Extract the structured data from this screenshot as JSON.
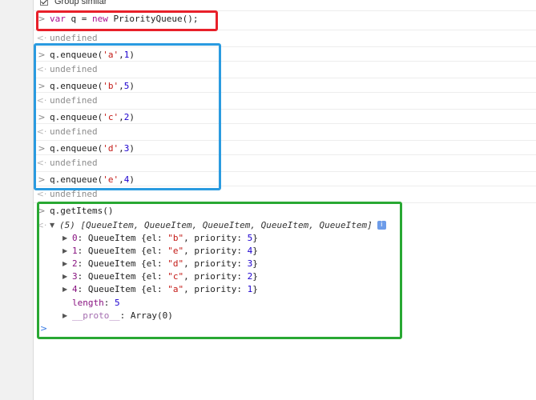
{
  "toolbar": {
    "group_similar_label": "Group similar",
    "group_similar_checked": true
  },
  "console": {
    "entries": [
      {
        "type": "input",
        "tokens": [
          {
            "t": "kw",
            "v": "var"
          },
          {
            "t": "txt",
            "v": " q = "
          },
          {
            "t": "kw",
            "v": "new"
          },
          {
            "t": "txt",
            "v": " PriorityQueue();"
          }
        ]
      },
      {
        "type": "result",
        "text": "undefined"
      },
      {
        "type": "input",
        "tokens": [
          {
            "t": "txt",
            "v": "q.enqueue("
          },
          {
            "t": "str",
            "v": "'a'"
          },
          {
            "t": "txt",
            "v": ","
          },
          {
            "t": "num",
            "v": "1"
          },
          {
            "t": "txt",
            "v": ")"
          }
        ]
      },
      {
        "type": "result",
        "text": "undefined"
      },
      {
        "type": "input",
        "tokens": [
          {
            "t": "txt",
            "v": "q.enqueue("
          },
          {
            "t": "str",
            "v": "'b'"
          },
          {
            "t": "txt",
            "v": ","
          },
          {
            "t": "num",
            "v": "5"
          },
          {
            "t": "txt",
            "v": ")"
          }
        ]
      },
      {
        "type": "result",
        "text": "undefined"
      },
      {
        "type": "input",
        "tokens": [
          {
            "t": "txt",
            "v": "q.enqueue("
          },
          {
            "t": "str",
            "v": "'c'"
          },
          {
            "t": "txt",
            "v": ","
          },
          {
            "t": "num",
            "v": "2"
          },
          {
            "t": "txt",
            "v": ")"
          }
        ]
      },
      {
        "type": "result",
        "text": "undefined"
      },
      {
        "type": "input",
        "tokens": [
          {
            "t": "txt",
            "v": "q.enqueue("
          },
          {
            "t": "str",
            "v": "'d'"
          },
          {
            "t": "txt",
            "v": ","
          },
          {
            "t": "num",
            "v": "3"
          },
          {
            "t": "txt",
            "v": ")"
          }
        ]
      },
      {
        "type": "result",
        "text": "undefined"
      },
      {
        "type": "input",
        "tokens": [
          {
            "t": "txt",
            "v": "q.enqueue("
          },
          {
            "t": "str",
            "v": "'e'"
          },
          {
            "t": "txt",
            "v": ","
          },
          {
            "t": "num",
            "v": "4"
          },
          {
            "t": "txt",
            "v": ")"
          }
        ]
      },
      {
        "type": "result",
        "text": "undefined"
      },
      {
        "type": "input",
        "tokens": [
          {
            "t": "txt",
            "v": "q.getItems()"
          }
        ]
      }
    ],
    "array_output": {
      "summary": "(5) [QueueItem, QueueItem, QueueItem, QueueItem, QueueItem]",
      "info_icon": "i",
      "items": [
        {
          "index": "0",
          "type_name": "QueueItem",
          "el": "\"b\"",
          "priority": "5"
        },
        {
          "index": "1",
          "type_name": "QueueItem",
          "el": "\"e\"",
          "priority": "4"
        },
        {
          "index": "2",
          "type_name": "QueueItem",
          "el": "\"d\"",
          "priority": "3"
        },
        {
          "index": "3",
          "type_name": "QueueItem",
          "el": "\"c\"",
          "priority": "2"
        },
        {
          "index": "4",
          "type_name": "QueueItem",
          "el": "\"a\"",
          "priority": "1"
        }
      ],
      "length_key": "length",
      "length_value": "5",
      "proto_key": "__proto__",
      "proto_value": "Array(0)"
    },
    "prompt_symbol": ">",
    "result_symbol": "<·",
    "caret_symbol": ">"
  },
  "annotation_colors": {
    "red": "#e8202a",
    "blue": "#2a9be0",
    "green": "#29a833"
  }
}
